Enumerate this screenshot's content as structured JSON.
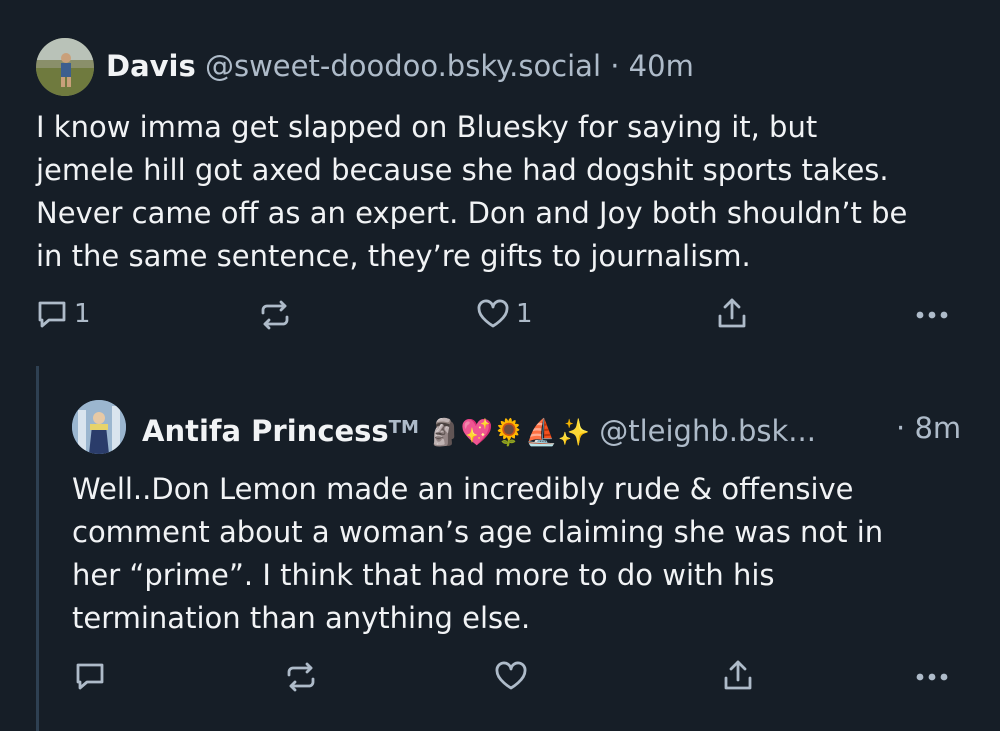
{
  "posts": [
    {
      "author": "Davis",
      "handle": "@sweet-doodoo.bsky.social",
      "sep": "·",
      "time": "40m",
      "text": "I know imma get slapped on Bluesky for saying it, but\njemele hill got axed because she had dogshit sports takes.\nNever came off as an expert. Don and Joy both shouldn’t be\nin the same sentence, they’re gifts to journalism.",
      "reply_count": "1",
      "like_count": "1"
    },
    {
      "author": "Antifa Princess",
      "tm": "TM",
      "emojis": "🗿💖🌻⛵✨",
      "handle": "@tleighb.bsk...",
      "sep": "·",
      "time": "8m",
      "text": "Well..Don Lemon made an incredibly rude & offensive\ncomment about a woman’s age claiming she was not in\nher “prime”. I think that had more to do with his\ntermination than anything else.",
      "reply_count": "",
      "like_count": ""
    }
  ],
  "icons": {
    "reply": "reply-bubble-icon",
    "repost": "repost-icon",
    "like": "heart-icon",
    "share": "share-icon",
    "more": "more-dots-icon"
  },
  "colors": {
    "background": "#161e27",
    "text": "#f1f3f5",
    "muted": "#aebbc9",
    "thread_line": "#2e4052"
  }
}
